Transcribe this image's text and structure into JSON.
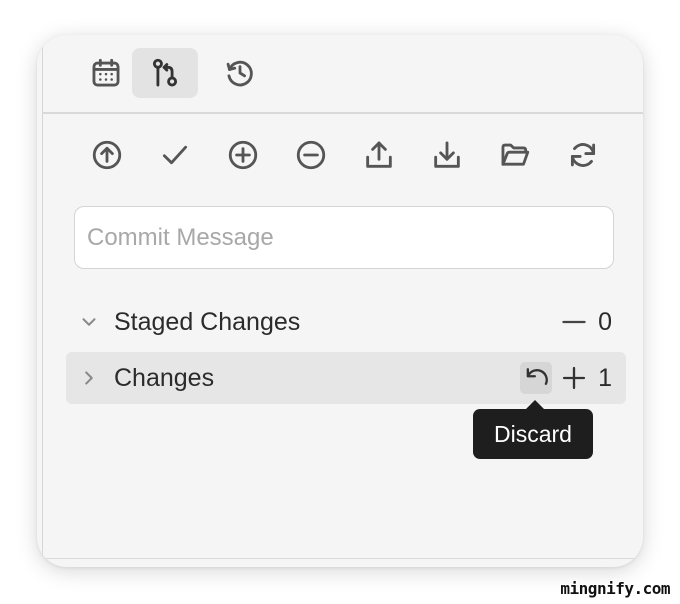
{
  "tabs": [
    {
      "icon": "calendar-icon",
      "active": false
    },
    {
      "icon": "source-control-icon",
      "active": true
    },
    {
      "icon": "history-icon",
      "active": false
    }
  ],
  "toolbar": [
    {
      "icon": "arrow-up-circle-icon"
    },
    {
      "icon": "checkmark-icon"
    },
    {
      "icon": "plus-circle-icon"
    },
    {
      "icon": "minus-circle-icon"
    },
    {
      "icon": "upload-icon"
    },
    {
      "icon": "download-icon"
    },
    {
      "icon": "folder-open-icon"
    },
    {
      "icon": "refresh-icon"
    }
  ],
  "commit": {
    "placeholder": "Commit Message",
    "value": ""
  },
  "groups": {
    "staged": {
      "label": "Staged Changes",
      "count": "0",
      "expanded": true
    },
    "changes": {
      "label": "Changes",
      "count": "1",
      "expanded": false
    }
  },
  "tooltip": {
    "text": "Discard"
  },
  "watermark": {
    "text": "mingnify.com"
  }
}
